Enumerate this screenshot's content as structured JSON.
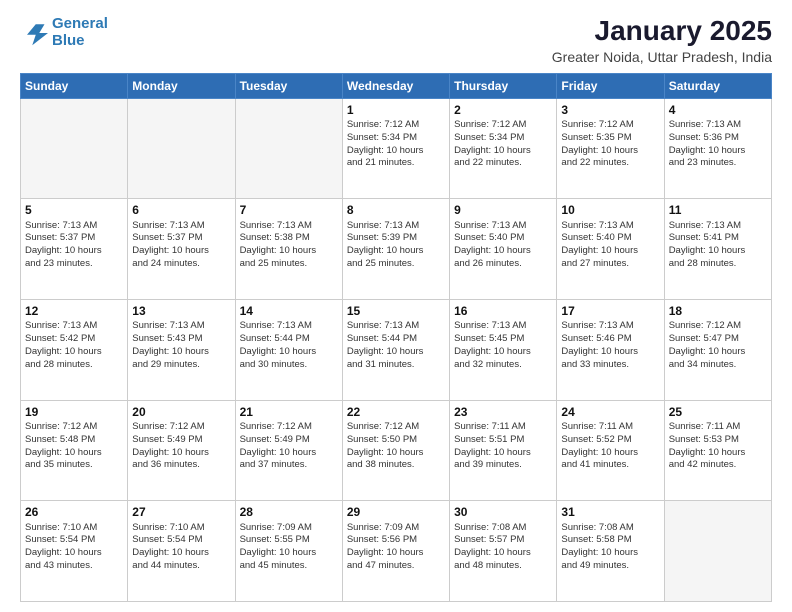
{
  "header": {
    "logo_line1": "General",
    "logo_line2": "Blue",
    "month": "January 2025",
    "location": "Greater Noida, Uttar Pradesh, India"
  },
  "weekdays": [
    "Sunday",
    "Monday",
    "Tuesday",
    "Wednesday",
    "Thursday",
    "Friday",
    "Saturday"
  ],
  "weeks": [
    [
      {
        "day": "",
        "info": ""
      },
      {
        "day": "",
        "info": ""
      },
      {
        "day": "",
        "info": ""
      },
      {
        "day": "1",
        "info": "Sunrise: 7:12 AM\nSunset: 5:34 PM\nDaylight: 10 hours\nand 21 minutes."
      },
      {
        "day": "2",
        "info": "Sunrise: 7:12 AM\nSunset: 5:34 PM\nDaylight: 10 hours\nand 22 minutes."
      },
      {
        "day": "3",
        "info": "Sunrise: 7:12 AM\nSunset: 5:35 PM\nDaylight: 10 hours\nand 22 minutes."
      },
      {
        "day": "4",
        "info": "Sunrise: 7:13 AM\nSunset: 5:36 PM\nDaylight: 10 hours\nand 23 minutes."
      }
    ],
    [
      {
        "day": "5",
        "info": "Sunrise: 7:13 AM\nSunset: 5:37 PM\nDaylight: 10 hours\nand 23 minutes."
      },
      {
        "day": "6",
        "info": "Sunrise: 7:13 AM\nSunset: 5:37 PM\nDaylight: 10 hours\nand 24 minutes."
      },
      {
        "day": "7",
        "info": "Sunrise: 7:13 AM\nSunset: 5:38 PM\nDaylight: 10 hours\nand 25 minutes."
      },
      {
        "day": "8",
        "info": "Sunrise: 7:13 AM\nSunset: 5:39 PM\nDaylight: 10 hours\nand 25 minutes."
      },
      {
        "day": "9",
        "info": "Sunrise: 7:13 AM\nSunset: 5:40 PM\nDaylight: 10 hours\nand 26 minutes."
      },
      {
        "day": "10",
        "info": "Sunrise: 7:13 AM\nSunset: 5:40 PM\nDaylight: 10 hours\nand 27 minutes."
      },
      {
        "day": "11",
        "info": "Sunrise: 7:13 AM\nSunset: 5:41 PM\nDaylight: 10 hours\nand 28 minutes."
      }
    ],
    [
      {
        "day": "12",
        "info": "Sunrise: 7:13 AM\nSunset: 5:42 PM\nDaylight: 10 hours\nand 28 minutes."
      },
      {
        "day": "13",
        "info": "Sunrise: 7:13 AM\nSunset: 5:43 PM\nDaylight: 10 hours\nand 29 minutes."
      },
      {
        "day": "14",
        "info": "Sunrise: 7:13 AM\nSunset: 5:44 PM\nDaylight: 10 hours\nand 30 minutes."
      },
      {
        "day": "15",
        "info": "Sunrise: 7:13 AM\nSunset: 5:44 PM\nDaylight: 10 hours\nand 31 minutes."
      },
      {
        "day": "16",
        "info": "Sunrise: 7:13 AM\nSunset: 5:45 PM\nDaylight: 10 hours\nand 32 minutes."
      },
      {
        "day": "17",
        "info": "Sunrise: 7:13 AM\nSunset: 5:46 PM\nDaylight: 10 hours\nand 33 minutes."
      },
      {
        "day": "18",
        "info": "Sunrise: 7:12 AM\nSunset: 5:47 PM\nDaylight: 10 hours\nand 34 minutes."
      }
    ],
    [
      {
        "day": "19",
        "info": "Sunrise: 7:12 AM\nSunset: 5:48 PM\nDaylight: 10 hours\nand 35 minutes."
      },
      {
        "day": "20",
        "info": "Sunrise: 7:12 AM\nSunset: 5:49 PM\nDaylight: 10 hours\nand 36 minutes."
      },
      {
        "day": "21",
        "info": "Sunrise: 7:12 AM\nSunset: 5:49 PM\nDaylight: 10 hours\nand 37 minutes."
      },
      {
        "day": "22",
        "info": "Sunrise: 7:12 AM\nSunset: 5:50 PM\nDaylight: 10 hours\nand 38 minutes."
      },
      {
        "day": "23",
        "info": "Sunrise: 7:11 AM\nSunset: 5:51 PM\nDaylight: 10 hours\nand 39 minutes."
      },
      {
        "day": "24",
        "info": "Sunrise: 7:11 AM\nSunset: 5:52 PM\nDaylight: 10 hours\nand 41 minutes."
      },
      {
        "day": "25",
        "info": "Sunrise: 7:11 AM\nSunset: 5:53 PM\nDaylight: 10 hours\nand 42 minutes."
      }
    ],
    [
      {
        "day": "26",
        "info": "Sunrise: 7:10 AM\nSunset: 5:54 PM\nDaylight: 10 hours\nand 43 minutes."
      },
      {
        "day": "27",
        "info": "Sunrise: 7:10 AM\nSunset: 5:54 PM\nDaylight: 10 hours\nand 44 minutes."
      },
      {
        "day": "28",
        "info": "Sunrise: 7:09 AM\nSunset: 5:55 PM\nDaylight: 10 hours\nand 45 minutes."
      },
      {
        "day": "29",
        "info": "Sunrise: 7:09 AM\nSunset: 5:56 PM\nDaylight: 10 hours\nand 47 minutes."
      },
      {
        "day": "30",
        "info": "Sunrise: 7:08 AM\nSunset: 5:57 PM\nDaylight: 10 hours\nand 48 minutes."
      },
      {
        "day": "31",
        "info": "Sunrise: 7:08 AM\nSunset: 5:58 PM\nDaylight: 10 hours\nand 49 minutes."
      },
      {
        "day": "",
        "info": ""
      }
    ]
  ]
}
